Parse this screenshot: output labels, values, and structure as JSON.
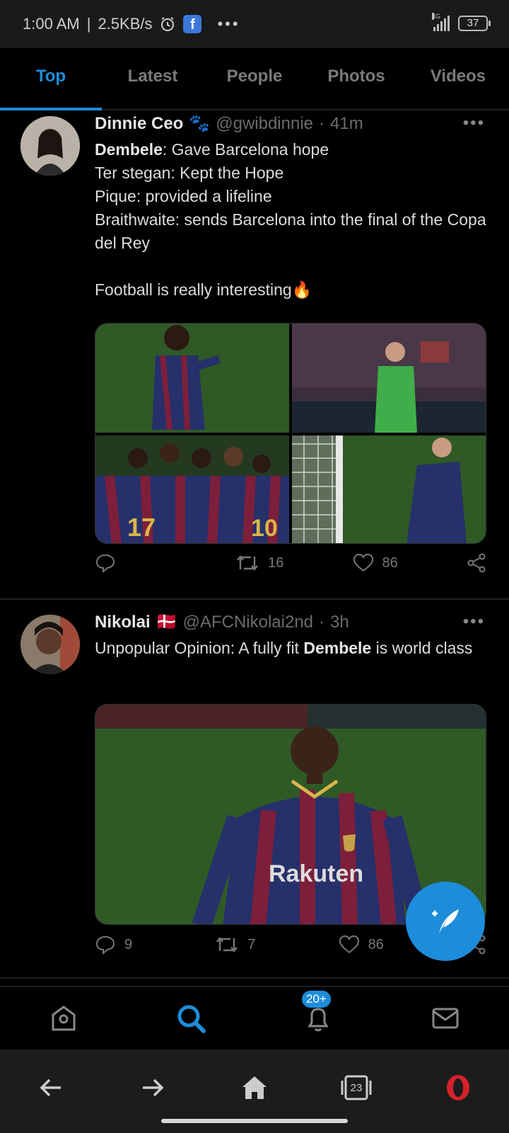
{
  "status_bar": {
    "time": "1:00 AM",
    "speed": "2.5KB/s",
    "alarm_icon": "alarm-clock-icon",
    "fb_icon": "facebook-icon",
    "fb_letter": "f",
    "more": "•••",
    "network": "4G",
    "battery": "37"
  },
  "tabs": [
    {
      "label": "Top",
      "active": true
    },
    {
      "label": "Latest",
      "active": false
    },
    {
      "label": "People",
      "active": false
    },
    {
      "label": "Photos",
      "active": false
    },
    {
      "label": "Videos",
      "active": false
    }
  ],
  "tweets": [
    {
      "name": "Dinnie Ceo",
      "emoji": "🐾",
      "handle": "@gwibdinnie",
      "dot": "·",
      "time": "41m",
      "more": "•••",
      "lines": [
        {
          "bold": "Dembele",
          "text": ": Gave Barcelona hope"
        },
        {
          "bold": "",
          "text": "Ter stegan: Kept the Hope"
        },
        {
          "bold": "",
          "text": "Pique: provided a lifeline"
        },
        {
          "bold": "",
          "text": "Braithwaite: sends Barcelona into the final of the Copa del Rey"
        },
        {
          "bold": "",
          "text": ""
        },
        {
          "bold": "",
          "text": "Football is really interesting🔥"
        }
      ],
      "replies": "",
      "retweets": "16",
      "likes": "86"
    },
    {
      "name": "Nikolai",
      "emoji": "🇩🇰",
      "handle": "@AFCNikolai2nd",
      "dot": "·",
      "time": "3h",
      "more": "•••",
      "text_before": "Unpopular Opinion: A fully fit ",
      "text_bold": "Dembele",
      "text_after": " is world class",
      "replies": "9",
      "retweets": "7",
      "likes": "86"
    }
  ],
  "bottom_nav": {
    "badge": "20+"
  },
  "browser_bar": {
    "tabs_count": "23"
  },
  "colors": {
    "accent": "#1d8ddb",
    "background": "#000000"
  }
}
